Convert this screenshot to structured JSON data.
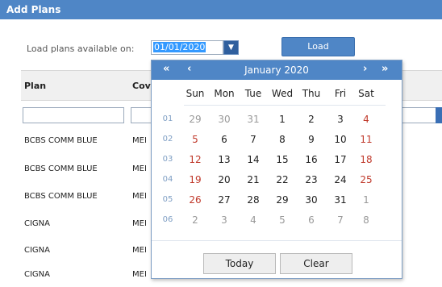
{
  "window": {
    "title": "Add Plans"
  },
  "load": {
    "label": "Load plans available on:",
    "date_value": "01/01/2020",
    "button": "Load"
  },
  "grid": {
    "columns": [
      "Plan",
      "Cov"
    ],
    "rows": [
      {
        "plan": "BCBS COMM BLUE",
        "coverage": "MEI"
      },
      {
        "plan": "BCBS COMM BLUE",
        "coverage": "MEI"
      },
      {
        "plan": "BCBS COMM BLUE",
        "coverage": "MEI"
      },
      {
        "plan": "CIGNA",
        "coverage": "MEI"
      },
      {
        "plan": "CIGNA",
        "coverage": "MEI"
      },
      {
        "plan": "CIGNA",
        "coverage": "MEI"
      }
    ]
  },
  "calendar": {
    "month_title": "January 2020",
    "nav": {
      "prev_year": "«",
      "prev_month": "‹",
      "next_month": "›",
      "next_year": "»"
    },
    "weekdays": [
      "Sun",
      "Mon",
      "Tue",
      "Wed",
      "Thu",
      "Fri",
      "Sat"
    ],
    "weeks": [
      {
        "num": "01",
        "days": [
          "29",
          "30",
          "31",
          "1",
          "2",
          "3",
          "4"
        ]
      },
      {
        "num": "02",
        "days": [
          "5",
          "6",
          "7",
          "8",
          "9",
          "10",
          "11"
        ]
      },
      {
        "num": "03",
        "days": [
          "12",
          "13",
          "14",
          "15",
          "16",
          "17",
          "18"
        ]
      },
      {
        "num": "04",
        "days": [
          "19",
          "20",
          "21",
          "22",
          "23",
          "24",
          "25"
        ]
      },
      {
        "num": "05",
        "days": [
          "26",
          "27",
          "28",
          "29",
          "30",
          "31",
          "1"
        ]
      },
      {
        "num": "06",
        "days": [
          "2",
          "3",
          "4",
          "5",
          "6",
          "7",
          "8"
        ]
      }
    ],
    "today_button": "Today",
    "clear_button": "Clear"
  },
  "colors": {
    "header_blue": "#4f86c6",
    "weekend_red": "#c0392b",
    "other_month_grey": "#999999"
  }
}
